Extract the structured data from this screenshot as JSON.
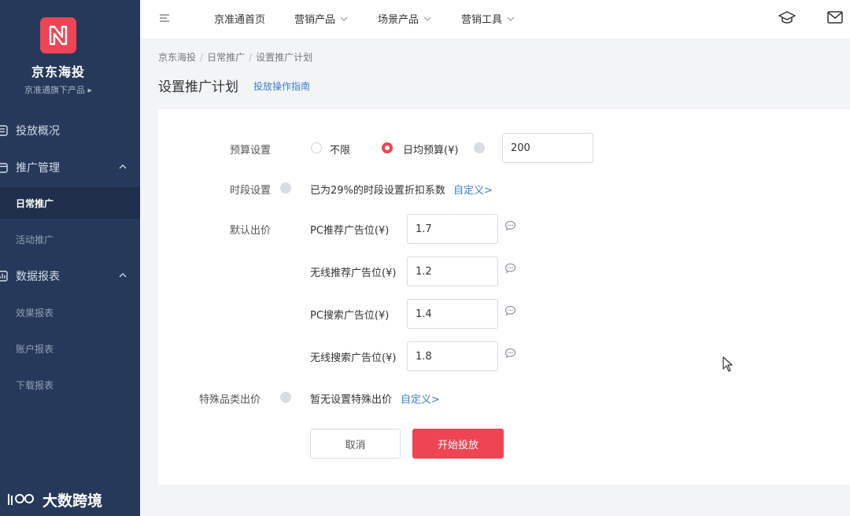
{
  "brand": {
    "title": "京东海投",
    "subtitle": "京准通旗下产品 ▸"
  },
  "sidebar": {
    "items": [
      {
        "label": "投放概况"
      },
      {
        "label": "推广管理"
      },
      {
        "label": "日常推广"
      },
      {
        "label": "活动推广"
      },
      {
        "label": "数据报表"
      },
      {
        "label": "效果报表"
      },
      {
        "label": "账户报表"
      },
      {
        "label": "下载报表"
      }
    ]
  },
  "watermark": {
    "text": "大数跨境"
  },
  "topnav": {
    "items": [
      {
        "label": "京准通首页"
      },
      {
        "label": "营销产品"
      },
      {
        "label": "场景产品"
      },
      {
        "label": "营销工具"
      }
    ]
  },
  "breadcrumb": {
    "items": [
      "京东海投",
      "日常推广",
      "设置推广计划"
    ]
  },
  "page": {
    "title": "设置推广计划",
    "guide_link": "投放操作指南"
  },
  "form": {
    "budget": {
      "label": "预算设置",
      "option_unlimited": "不限",
      "option_daily": "日均预算(¥)",
      "value": "200"
    },
    "time": {
      "label": "时段设置",
      "text": "已为29%的时段设置折扣系数",
      "link": "自定义>"
    },
    "bid": {
      "label": "默认出价",
      "rows": [
        {
          "label": "PC推荐广告位(¥)",
          "value": "1.7"
        },
        {
          "label": "无线推荐广告位(¥)",
          "value": "1.2"
        },
        {
          "label": "PC搜索广告位(¥)",
          "value": "1.4"
        },
        {
          "label": "无线搜索广告位(¥)",
          "value": "1.8"
        }
      ]
    },
    "special": {
      "label": "特殊品类出价",
      "text": "暂无设置特殊出价",
      "link": "自定义>"
    },
    "cancel_label": "取消",
    "submit_label": "开始投放"
  }
}
